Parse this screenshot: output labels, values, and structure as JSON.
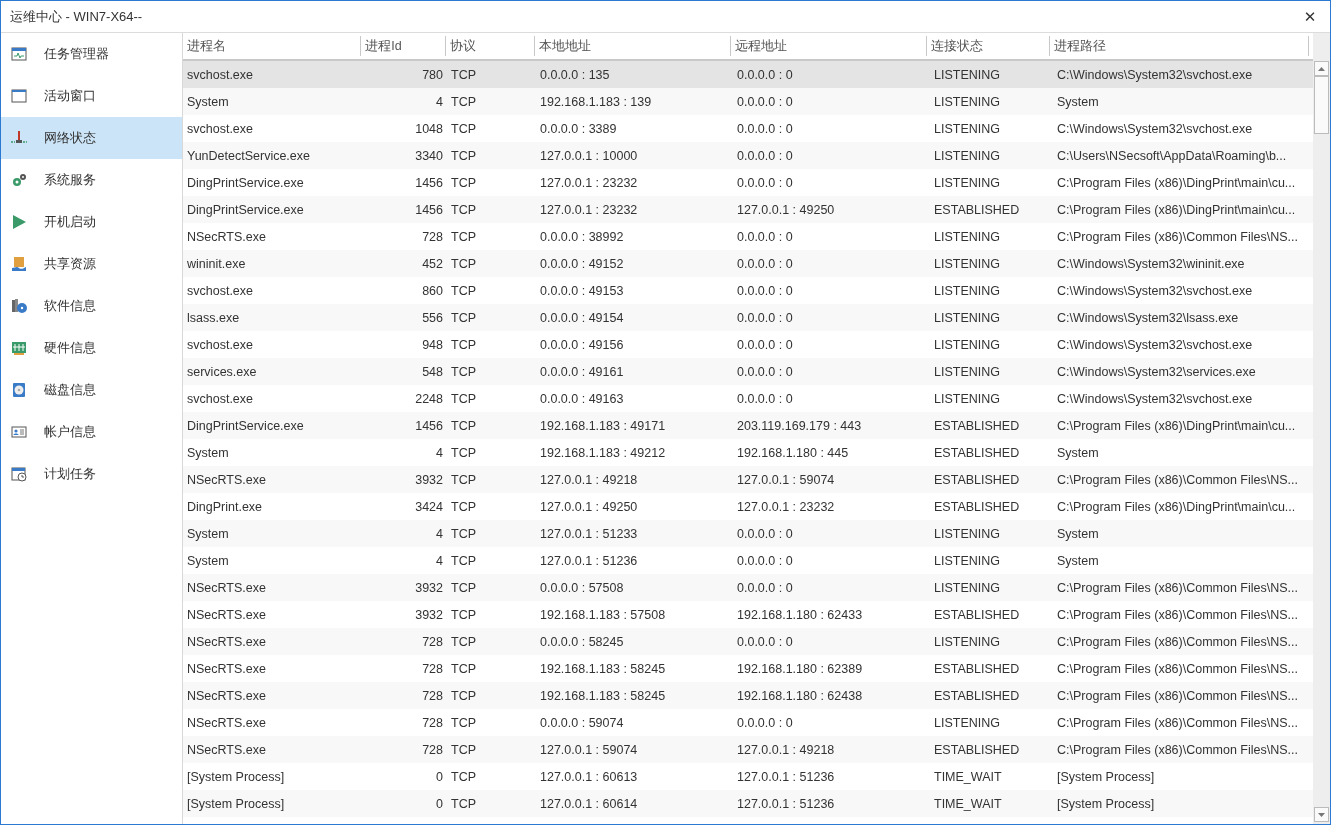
{
  "window": {
    "title": "运维中心 - WIN7-X64--",
    "close": "✕"
  },
  "sidebar": {
    "items": [
      {
        "label": "任务管理器",
        "selected": false
      },
      {
        "label": "活动窗口",
        "selected": false
      },
      {
        "label": "网络状态",
        "selected": true
      },
      {
        "label": "系统服务",
        "selected": false
      },
      {
        "label": "开机启动",
        "selected": false
      },
      {
        "label": "共享资源",
        "selected": false
      },
      {
        "label": "软件信息",
        "selected": false
      },
      {
        "label": "硬件信息",
        "selected": false
      },
      {
        "label": "磁盘信息",
        "selected": false
      },
      {
        "label": "帐户信息",
        "selected": false
      },
      {
        "label": "计划任务",
        "selected": false
      }
    ]
  },
  "table": {
    "columns": [
      "进程名",
      "进程Id",
      "协议",
      "本地地址",
      "远程地址",
      "连接状态",
      "进程路径"
    ],
    "rows": [
      {
        "selected": true,
        "cells": [
          "svchost.exe",
          "780",
          "TCP",
          "0.0.0.0 : 135",
          "0.0.0.0 : 0",
          "LISTENING",
          "C:\\Windows\\System32\\svchost.exe"
        ]
      },
      {
        "selected": false,
        "cells": [
          "System",
          "4",
          "TCP",
          "192.168.1.183 : 139",
          "0.0.0.0 : 0",
          "LISTENING",
          "System"
        ]
      },
      {
        "selected": false,
        "cells": [
          "svchost.exe",
          "1048",
          "TCP",
          "0.0.0.0 : 3389",
          "0.0.0.0 : 0",
          "LISTENING",
          "C:\\Windows\\System32\\svchost.exe"
        ]
      },
      {
        "selected": false,
        "cells": [
          "YunDetectService.exe",
          "3340",
          "TCP",
          "127.0.0.1 : 10000",
          "0.0.0.0 : 0",
          "LISTENING",
          "C:\\Users\\NSecsoft\\AppData\\Roaming\\b..."
        ]
      },
      {
        "selected": false,
        "cells": [
          "DingPrintService.exe",
          "1456",
          "TCP",
          "127.0.0.1 : 23232",
          "0.0.0.0 : 0",
          "LISTENING",
          "C:\\Program Files (x86)\\DingPrint\\main\\cu..."
        ]
      },
      {
        "selected": false,
        "cells": [
          "DingPrintService.exe",
          "1456",
          "TCP",
          "127.0.0.1 : 23232",
          "127.0.0.1 : 49250",
          "ESTABLISHED",
          "C:\\Program Files (x86)\\DingPrint\\main\\cu..."
        ]
      },
      {
        "selected": false,
        "cells": [
          "NSecRTS.exe",
          "728",
          "TCP",
          "0.0.0.0 : 38992",
          "0.0.0.0 : 0",
          "LISTENING",
          "C:\\Program Files (x86)\\Common Files\\NS..."
        ]
      },
      {
        "selected": false,
        "cells": [
          "wininit.exe",
          "452",
          "TCP",
          "0.0.0.0 : 49152",
          "0.0.0.0 : 0",
          "LISTENING",
          "C:\\Windows\\System32\\wininit.exe"
        ]
      },
      {
        "selected": false,
        "cells": [
          "svchost.exe",
          "860",
          "TCP",
          "0.0.0.0 : 49153",
          "0.0.0.0 : 0",
          "LISTENING",
          "C:\\Windows\\System32\\svchost.exe"
        ]
      },
      {
        "selected": false,
        "cells": [
          "lsass.exe",
          "556",
          "TCP",
          "0.0.0.0 : 49154",
          "0.0.0.0 : 0",
          "LISTENING",
          "C:\\Windows\\System32\\lsass.exe"
        ]
      },
      {
        "selected": false,
        "cells": [
          "svchost.exe",
          "948",
          "TCP",
          "0.0.0.0 : 49156",
          "0.0.0.0 : 0",
          "LISTENING",
          "C:\\Windows\\System32\\svchost.exe"
        ]
      },
      {
        "selected": false,
        "cells": [
          "services.exe",
          "548",
          "TCP",
          "0.0.0.0 : 49161",
          "0.0.0.0 : 0",
          "LISTENING",
          "C:\\Windows\\System32\\services.exe"
        ]
      },
      {
        "selected": false,
        "cells": [
          "svchost.exe",
          "2248",
          "TCP",
          "0.0.0.0 : 49163",
          "0.0.0.0 : 0",
          "LISTENING",
          "C:\\Windows\\System32\\svchost.exe"
        ]
      },
      {
        "selected": false,
        "cells": [
          "DingPrintService.exe",
          "1456",
          "TCP",
          "192.168.1.183 : 49171",
          "203.119.169.179 : 443",
          "ESTABLISHED",
          "C:\\Program Files (x86)\\DingPrint\\main\\cu..."
        ]
      },
      {
        "selected": false,
        "cells": [
          "System",
          "4",
          "TCP",
          "192.168.1.183 : 49212",
          "192.168.1.180 : 445",
          "ESTABLISHED",
          "System"
        ]
      },
      {
        "selected": false,
        "cells": [
          "NSecRTS.exe",
          "3932",
          "TCP",
          "127.0.0.1 : 49218",
          "127.0.0.1 : 59074",
          "ESTABLISHED",
          "C:\\Program Files (x86)\\Common Files\\NS..."
        ]
      },
      {
        "selected": false,
        "cells": [
          "DingPrint.exe",
          "3424",
          "TCP",
          "127.0.0.1 : 49250",
          "127.0.0.1 : 23232",
          "ESTABLISHED",
          "C:\\Program Files (x86)\\DingPrint\\main\\cu..."
        ]
      },
      {
        "selected": false,
        "cells": [
          "System",
          "4",
          "TCP",
          "127.0.0.1 : 51233",
          "0.0.0.0 : 0",
          "LISTENING",
          "System"
        ]
      },
      {
        "selected": false,
        "cells": [
          "System",
          "4",
          "TCP",
          "127.0.0.1 : 51236",
          "0.0.0.0 : 0",
          "LISTENING",
          "System"
        ]
      },
      {
        "selected": false,
        "cells": [
          "NSecRTS.exe",
          "3932",
          "TCP",
          "0.0.0.0 : 57508",
          "0.0.0.0 : 0",
          "LISTENING",
          "C:\\Program Files (x86)\\Common Files\\NS..."
        ]
      },
      {
        "selected": false,
        "cells": [
          "NSecRTS.exe",
          "3932",
          "TCP",
          "192.168.1.183 : 57508",
          "192.168.1.180 : 62433",
          "ESTABLISHED",
          "C:\\Program Files (x86)\\Common Files\\NS..."
        ]
      },
      {
        "selected": false,
        "cells": [
          "NSecRTS.exe",
          "728",
          "TCP",
          "0.0.0.0 : 58245",
          "0.0.0.0 : 0",
          "LISTENING",
          "C:\\Program Files (x86)\\Common Files\\NS..."
        ]
      },
      {
        "selected": false,
        "cells": [
          "NSecRTS.exe",
          "728",
          "TCP",
          "192.168.1.183 : 58245",
          "192.168.1.180 : 62389",
          "ESTABLISHED",
          "C:\\Program Files (x86)\\Common Files\\NS..."
        ]
      },
      {
        "selected": false,
        "cells": [
          "NSecRTS.exe",
          "728",
          "TCP",
          "192.168.1.183 : 58245",
          "192.168.1.180 : 62438",
          "ESTABLISHED",
          "C:\\Program Files (x86)\\Common Files\\NS..."
        ]
      },
      {
        "selected": false,
        "cells": [
          "NSecRTS.exe",
          "728",
          "TCP",
          "0.0.0.0 : 59074",
          "0.0.0.0 : 0",
          "LISTENING",
          "C:\\Program Files (x86)\\Common Files\\NS..."
        ]
      },
      {
        "selected": false,
        "cells": [
          "NSecRTS.exe",
          "728",
          "TCP",
          "127.0.0.1 : 59074",
          "127.0.0.1 : 49218",
          "ESTABLISHED",
          "C:\\Program Files (x86)\\Common Files\\NS..."
        ]
      },
      {
        "selected": false,
        "cells": [
          "[System Process]",
          "0",
          "TCP",
          "127.0.0.1 : 60613",
          "127.0.0.1 : 51236",
          "TIME_WAIT",
          "[System Process]"
        ]
      },
      {
        "selected": false,
        "cells": [
          "[System Process]",
          "0",
          "TCP",
          "127.0.0.1 : 60614",
          "127.0.0.1 : 51236",
          "TIME_WAIT",
          "[System Process]"
        ]
      }
    ]
  }
}
